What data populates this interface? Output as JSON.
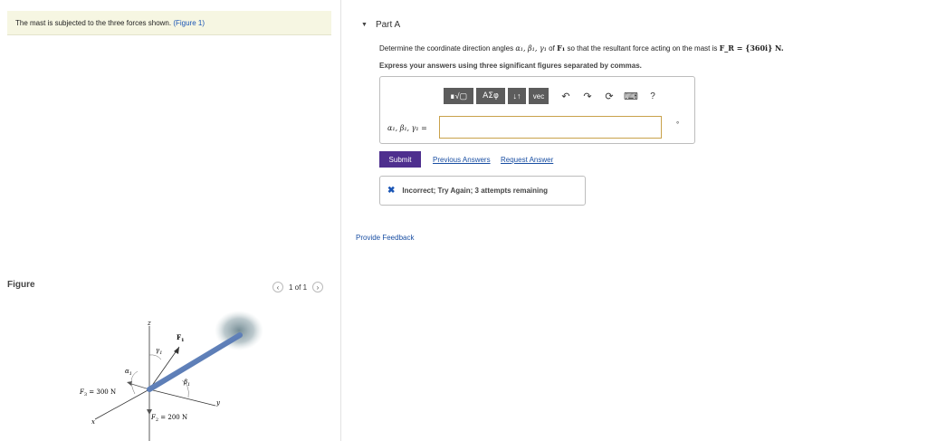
{
  "problem": {
    "statement": "The mast is subjected to the three forces shown.",
    "figure_link": "(Figure 1)"
  },
  "figure_panel": {
    "label": "Figure",
    "pager_text": "1 of 1",
    "prev_icon": "chevron-left",
    "next_icon": "chevron-right",
    "labels": {
      "z": "z",
      "y": "y",
      "x": "x",
      "F1": "F",
      "F1_sub": "1",
      "gamma1": "γ",
      "gamma1_sub": "1",
      "alpha1": "α",
      "alpha1_sub": "1",
      "beta1": "β",
      "beta1_sub": "1",
      "F3": "F",
      "F3_sub": "3",
      "F3_value": " = 300 N",
      "F2": "F",
      "F2_sub": "2",
      "F2_value": " = 200 N"
    }
  },
  "part": {
    "title": "Part A",
    "q_pre": "Determine the coordinate direction angles",
    "q_angles": "α₁, β₁, γ₁",
    "q_of": "of",
    "q_force": "F₁",
    "q_mid": "so that the resultant force acting on the mast is",
    "q_result": "F_R = {360i} N.",
    "instruction": "Express your answers using three significant figures separated by commas."
  },
  "toolbar": {
    "template_label": "∎√▢",
    "greek_label": "ΑΣφ",
    "sort_label": "↓↑",
    "vec_label": "vec",
    "undo_icon": "undo-icon",
    "redo_icon": "redo-icon",
    "reset_icon": "reset-icon",
    "keyboard_icon": "keyboard-icon",
    "help_label": "?"
  },
  "answer": {
    "input_label": "α₁, β₁, γ₁ =",
    "value": "",
    "unit": "°"
  },
  "actions": {
    "submit": "Submit",
    "previous_answers": "Previous Answers",
    "request_answer": "Request Answer"
  },
  "feedback": {
    "status_icon": "x-icon",
    "message": "Incorrect; Try Again; 3 attempts remaining",
    "provide_feedback": "Provide Feedback"
  },
  "colors": {
    "submit_bg": "#4e2f8e",
    "link": "#1a4fa3",
    "problem_bg": "#f6f6e2",
    "input_border": "#c9a24b",
    "mast": "#5e7fb8"
  }
}
